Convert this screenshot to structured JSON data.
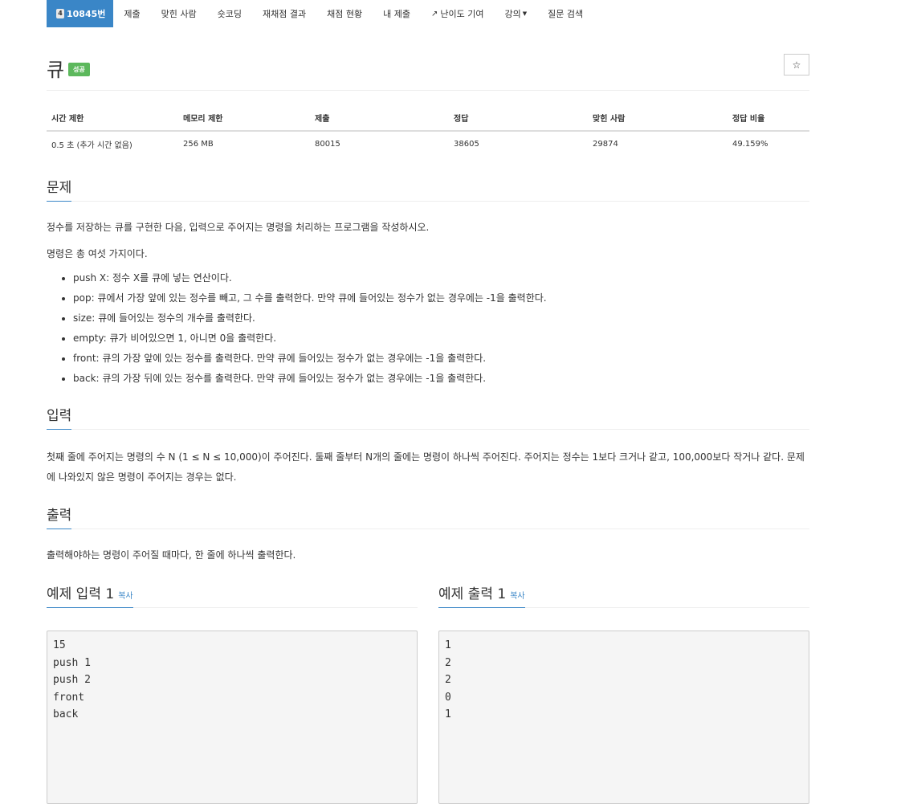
{
  "nav": {
    "problem_tier": "4",
    "problem_id": "10845번",
    "items": [
      "제출",
      "맞힌 사람",
      "숏코딩",
      "재채점 결과",
      "채점 현황",
      "내 제출",
      "난이도 기여",
      "강의",
      "질문 검색"
    ]
  },
  "problem": {
    "title": "큐",
    "badge": "성공",
    "star": "☆"
  },
  "info": {
    "headers": [
      "시간 제한",
      "메모리 제한",
      "제출",
      "정답",
      "맞힌 사람",
      "정답 비율"
    ],
    "values": [
      "0.5 초 (추가 시간 없음)",
      "256 MB",
      "80015",
      "38605",
      "29874",
      "49.159%"
    ]
  },
  "description": {
    "heading": "문제",
    "p1": "정수를 저장하는 큐를 구현한 다음, 입력으로 주어지는 명령을 처리하는 프로그램을 작성하시오.",
    "p2": "명령은 총 여섯 가지이다.",
    "commands": [
      "push X: 정수 X를 큐에 넣는 연산이다.",
      "pop: 큐에서 가장 앞에 있는 정수를 빼고, 그 수를 출력한다. 만약 큐에 들어있는 정수가 없는 경우에는 -1을 출력한다.",
      "size: 큐에 들어있는 정수의 개수를 출력한다.",
      "empty: 큐가 비어있으면 1, 아니면 0을 출력한다.",
      "front: 큐의 가장 앞에 있는 정수를 출력한다. 만약 큐에 들어있는 정수가 없는 경우에는 -1을 출력한다.",
      "back: 큐의 가장 뒤에 있는 정수를 출력한다. 만약 큐에 들어있는 정수가 없는 경우에는 -1을 출력한다."
    ]
  },
  "input": {
    "heading": "입력",
    "text": "첫째 줄에 주어지는 명령의 수 N (1 ≤ N ≤ 10,000)이 주어진다. 둘째 줄부터 N개의 줄에는 명령이 하나씩 주어진다. 주어지는 정수는 1보다 크거나 같고, 100,000보다 작거나 같다. 문제에 나와있지 않은 명령이 주어지는 경우는 없다."
  },
  "output": {
    "heading": "출력",
    "text": "출력해야하는 명령이 주어질 때마다, 한 줄에 하나씩 출력한다."
  },
  "samples": {
    "input_heading": "예제 입력 1",
    "output_heading": "예제 출력 1",
    "copy_label": "복사",
    "input_text": "15\npush 1\npush 2\nfront\nback",
    "output_text": "1\n2\n2\n0\n1"
  },
  "colors": {
    "primary": "#3a86c7",
    "success": "#5cb85c"
  }
}
